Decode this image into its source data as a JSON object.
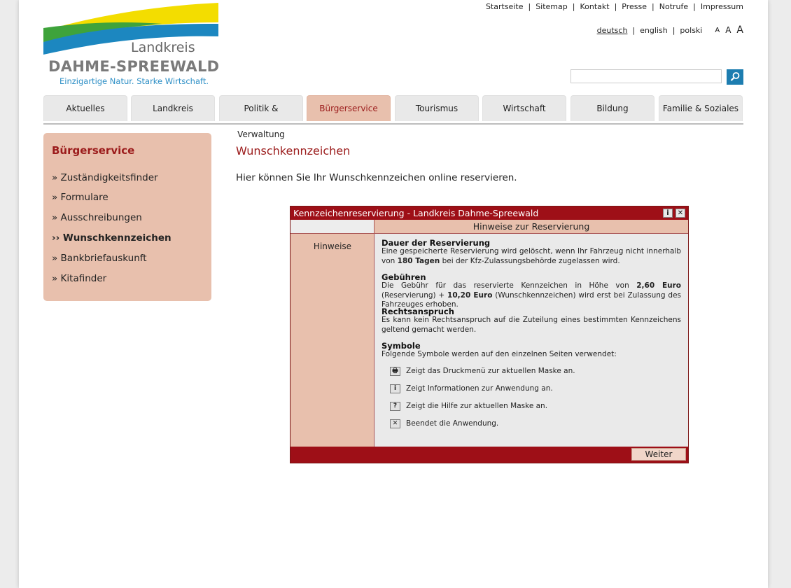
{
  "logo": {
    "line1": "Landkreis",
    "line2": "DAHME-SPREEWALD",
    "slogan": "Einzigartige Natur. Starke Wirtschaft.",
    "colors": {
      "yellow": "#f3dd00",
      "green": "#3ea33b",
      "blue": "#1c87c0"
    }
  },
  "toplinks": [
    "Startseite",
    "Sitemap",
    "Kontakt",
    "Presse",
    "Notrufe",
    "Impressum"
  ],
  "languages": {
    "items": [
      "deutsch",
      "english",
      "polski"
    ],
    "active": "deutsch"
  },
  "fontsize": [
    "A",
    "A",
    "A"
  ],
  "search": {
    "value": "",
    "icon": "search-icon"
  },
  "nav": {
    "tabs": [
      "Aktuelles",
      "Landkreis",
      "Politik & Verwaltung",
      "Bürgerservice",
      "Tourismus",
      "Wirtschaft",
      "Bildung",
      "Familie & Soziales"
    ],
    "active": "Bürgerservice"
  },
  "sidebar": {
    "title": "Bürgerservice",
    "items": [
      "» Zuständigkeitsfinder",
      "» Formulare",
      "» Ausschreibungen",
      "›› Wunschkennzeichen",
      "» Bankbriefauskunft",
      "» Kitafinder"
    ],
    "active": "›› Wunschkennzeichen"
  },
  "main": {
    "title": "Wunschkennzeichen",
    "intro": "Hier können Sie Ihr Wunschkennzeichen online reservieren."
  },
  "window": {
    "title": "Kennzeichenreservierung - Landkreis Dahme-Spreewald",
    "info_btn": "i",
    "close_btn": "✕",
    "header": "Hinweise zur Reservierung",
    "left_label": "Hinweise",
    "sections": [
      {
        "title": "Dauer der Reservierung",
        "text_a": "Eine gespeicherte Reservierung wird gelöscht, wenn Ihr Fahrzeug nicht innerhalb von ",
        "bold_a": "180 Tagen",
        "text_b": " bei der Kfz-Zulassungsbehörde zugelassen wird."
      },
      {
        "title": "Gebühren",
        "text_a": "Die Gebühr für das reservierte Kennzeichen in Höhe von ",
        "bold_a": "2,60 Euro",
        "text_b": " (Reservierung) + ",
        "bold_b": "10,20 Euro",
        "text_c": " (Wunschkennzeichen) wird erst bei Zulassung des Fahrzeuges erhoben."
      },
      {
        "title": "Rechtsanspruch",
        "text_a": "Es kann kein Rechtsanspruch auf die Zuteilung eines bestimmten Kennzeichens geltend gemacht werden."
      },
      {
        "title": "Symbole",
        "text_a": "Folgende Symbole werden auf den einzelnen Seiten verwendet:"
      }
    ],
    "symbols": [
      {
        "icon": "printer-icon",
        "glyph": "🖶",
        "text": "Zeigt das Druckmenü zur aktuellen Maske an."
      },
      {
        "icon": "info-icon",
        "glyph": "i",
        "text": "Zeigt Informationen zur Anwendung an."
      },
      {
        "icon": "help-icon",
        "glyph": "?",
        "text": "Zeigt die Hilfe zur aktuellen Maske an."
      },
      {
        "icon": "close-icon",
        "glyph": "✕",
        "text": "Beendet die Anwendung."
      }
    ],
    "button": "Weiter"
  },
  "colors": {
    "accent": "#9b1b1b",
    "salmon": "#e8c0ad",
    "window_red": "#9e0f17",
    "search_blue": "#1d7db0"
  }
}
